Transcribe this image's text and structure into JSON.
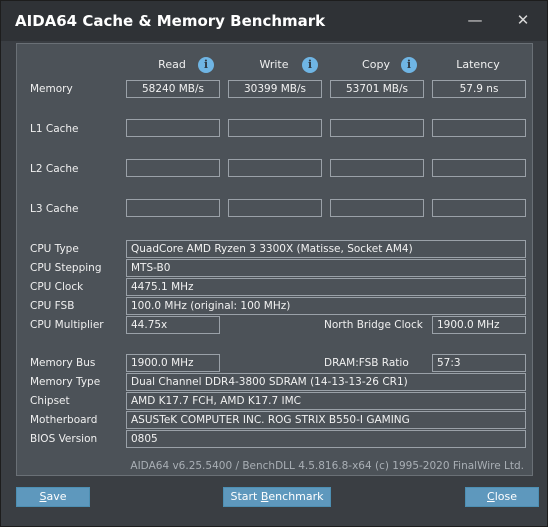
{
  "window": {
    "title": "AIDA64 Cache & Memory Benchmark",
    "minimize_glyph": "—",
    "close_glyph": "✕"
  },
  "columns": {
    "read": "Read",
    "write": "Write",
    "copy": "Copy",
    "latency": "Latency",
    "info_glyph": "i"
  },
  "rows": {
    "memory": {
      "label": "Memory",
      "read": "58240 MB/s",
      "write": "30399 MB/s",
      "copy": "53701 MB/s",
      "latency": "57.9 ns"
    },
    "l1": {
      "label": "L1 Cache",
      "read": "",
      "write": "",
      "copy": "",
      "latency": ""
    },
    "l2": {
      "label": "L2 Cache",
      "read": "",
      "write": "",
      "copy": "",
      "latency": ""
    },
    "l3": {
      "label": "L3 Cache",
      "read": "",
      "write": "",
      "copy": "",
      "latency": ""
    }
  },
  "cpu": {
    "type_label": "CPU Type",
    "type": "QuadCore AMD Ryzen 3 3300X  (Matisse, Socket AM4)",
    "stepping_label": "CPU Stepping",
    "stepping": "MTS-B0",
    "clock_label": "CPU Clock",
    "clock": "4475.1 MHz",
    "fsb_label": "CPU FSB",
    "fsb": "100.0 MHz  (original: 100 MHz)",
    "multiplier_label": "CPU Multiplier",
    "multiplier": "44.75x",
    "nb_clock_label": "North Bridge Clock",
    "nb_clock": "1900.0 MHz"
  },
  "system": {
    "bus_label": "Memory Bus",
    "bus": "1900.0 MHz",
    "ratio_label": "DRAM:FSB Ratio",
    "ratio": "57:3",
    "type_label": "Memory Type",
    "type": "Dual Channel DDR4-3800 SDRAM  (14-13-13-26 CR1)",
    "chipset_label": "Chipset",
    "chipset": "AMD K17.7 FCH, AMD K17.7 IMC",
    "motherboard_label": "Motherboard",
    "motherboard": "ASUSTeK COMPUTER INC. ROG STRIX B550-I GAMING",
    "bios_label": "BIOS Version",
    "bios": "0805"
  },
  "footer": "AIDA64 v6.25.5400 / BenchDLL 4.5.816.8-x64  (c) 1995-2020 FinalWire Ltd.",
  "buttons": {
    "save_u": "S",
    "save_rest": "ave",
    "start_pre": "Start ",
    "start_u": "B",
    "start_rest": "enchmark",
    "close_u": "C",
    "close_rest": "lose"
  },
  "colors": {
    "background": "#3a3e43",
    "panel": "#4c5258",
    "button": "#5e98bd",
    "info_icon": "#6fb5e4"
  }
}
